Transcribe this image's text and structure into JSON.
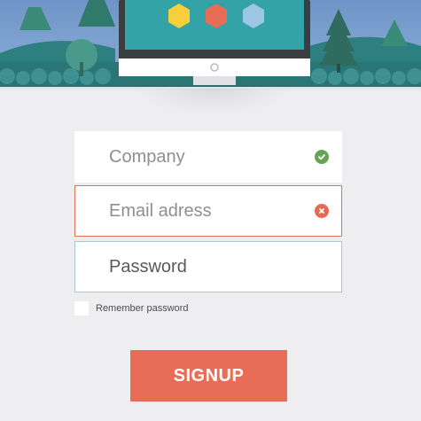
{
  "form": {
    "company": {
      "placeholder": "Company",
      "status": "valid"
    },
    "email": {
      "placeholder": "Email adress",
      "status": "invalid"
    },
    "password": {
      "value": "Password"
    },
    "remember_label": "Remember password",
    "signup_label": "SIGNUP"
  },
  "colors": {
    "accent": "#e86d56",
    "valid": "#66a35a",
    "invalid": "#e46a55",
    "screen": "#33a3a7",
    "hex_yellow": "#f6cf3a",
    "hex_red": "#e86d56",
    "hex_blue": "#9cc8e6"
  }
}
